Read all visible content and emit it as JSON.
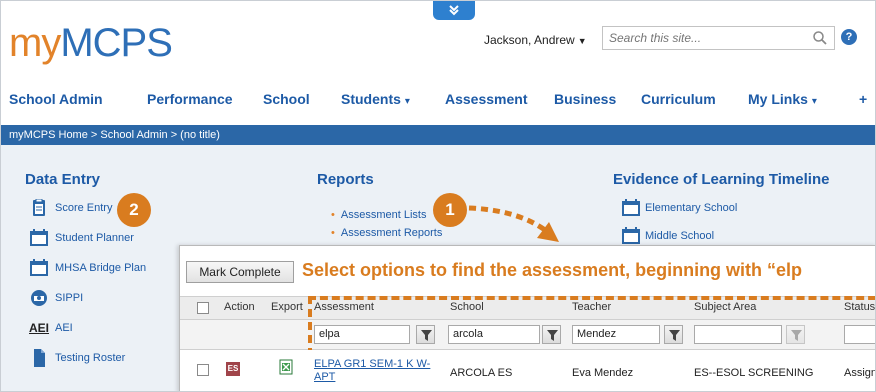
{
  "header": {
    "logo_my": "my",
    "logo_mcps": "MCPS",
    "user_name": "Jackson, Andrew",
    "search_placeholder": "Search this site..."
  },
  "nav": [
    {
      "label": "School Admin",
      "has_caret": false
    },
    {
      "label": "Performance",
      "has_caret": false
    },
    {
      "label": "School",
      "has_caret": false
    },
    {
      "label": "Students",
      "has_caret": true
    },
    {
      "label": "Assessment",
      "has_caret": false
    },
    {
      "label": "Business",
      "has_caret": false
    },
    {
      "label": "Curriculum",
      "has_caret": false
    },
    {
      "label": "My Links",
      "has_caret": true
    },
    {
      "label": "+",
      "has_caret": false
    }
  ],
  "breadcrumb": "myMCPS Home > School Admin > (no title)",
  "data_entry": {
    "title": "Data Entry",
    "items": [
      "Score Entry",
      "Student Planner",
      "MHSA Bridge Plan",
      "SIPPI",
      "AEI",
      "Testing Roster"
    ],
    "aei_logo": "AEI"
  },
  "reports": {
    "title": "Reports",
    "items": [
      "Assessment Lists",
      "Assessment Reports"
    ]
  },
  "timeline": {
    "title": "Evidence of Learning Timeline",
    "items": [
      "Elementary School",
      "Middle School"
    ]
  },
  "badges": {
    "one": "1",
    "two": "2"
  },
  "panel": {
    "mark_complete": "Mark Complete",
    "instruction": "Select options to find the assessment, beginning with “elp",
    "columns": [
      "Action",
      "Export",
      "Assessment",
      "School",
      "Teacher",
      "Subject Area",
      "Status"
    ],
    "filters": {
      "assessment": "elpa",
      "school": "arcola",
      "teacher": "Mendez",
      "subject": ""
    },
    "row": {
      "type_badge": "ES",
      "assessment": "ELPA GR1 SEM-1 K W-APT",
      "school": "ARCOLA ES",
      "teacher": "Eva Mendez",
      "subject": "ES--ESOL SCREENING",
      "status": "Assigne"
    }
  },
  "colors": {
    "brand_blue": "#2e6fb7",
    "brand_orange": "#e2832a",
    "accent_orange": "#d97c1f",
    "breadcrumb_bg": "#2b67a7"
  }
}
